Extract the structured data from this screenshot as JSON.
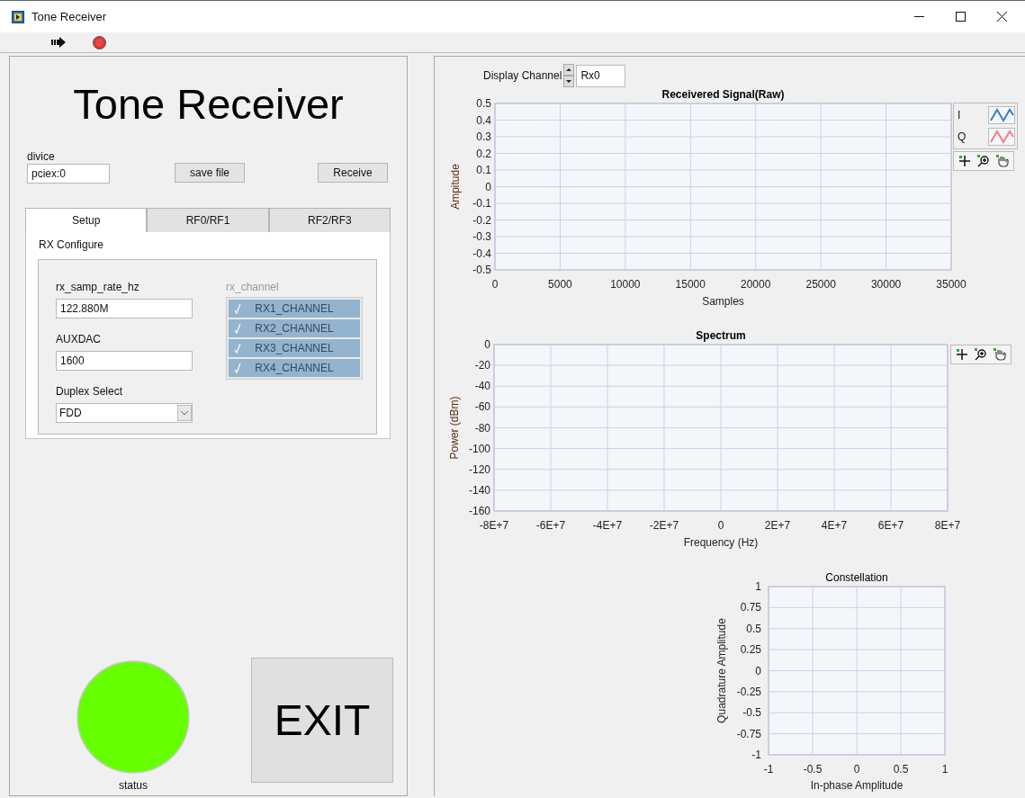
{
  "window": {
    "title": "Tone Receiver"
  },
  "heading": "Tone Receiver",
  "device": {
    "label": "divice",
    "value": "pciex:0"
  },
  "buttons": [
    "save file",
    "Receive"
  ],
  "tabs": [
    {
      "label": "Setup",
      "selected": true
    },
    {
      "label": "RF0/RF1",
      "selected": false
    },
    {
      "label": "RF2/RF3",
      "selected": false
    }
  ],
  "rx_configure": {
    "title": "RX Configure",
    "fields": [
      {
        "kind": "text",
        "label": "rx_samp_rate_hz",
        "value": "122.880M"
      },
      {
        "kind": "text",
        "label": "AUXDAC",
        "value": "1600"
      },
      {
        "kind": "dropdown",
        "label": "Duplex Select",
        "value": "FDD"
      }
    ],
    "rx_channel": {
      "label": "rx_channel",
      "disabled": true,
      "items": [
        {
          "label": "RX1_CHANNEL",
          "checked": true
        },
        {
          "label": "RX2_CHANNEL",
          "checked": true
        },
        {
          "label": "RX3_CHANNEL",
          "checked": true
        },
        {
          "label": "RX4_CHANNEL",
          "checked": true
        }
      ]
    }
  },
  "status": {
    "label": "status",
    "on": true
  },
  "exit_button": "EXIT",
  "display_channel": {
    "label": "Display Channel",
    "value": "Rx0"
  },
  "signal_graph": {
    "legend": [
      {
        "name": "I",
        "color": "#3a7fc1"
      },
      {
        "name": "Q",
        "color": "#f08080"
      }
    ],
    "chart_data": {
      "type": "line",
      "grid": true,
      "title": "Receivered Signal(Raw)",
      "xlabel": "Samples",
      "ylabel": "Ampitude",
      "xlim": [
        0,
        35000
      ],
      "ylim": [
        -0.5,
        0.5
      ],
      "xticks": [
        0,
        5000,
        10000,
        15000,
        20000,
        25000,
        30000,
        35000
      ],
      "yticks": [
        0.5,
        0.4,
        0.3,
        0.2,
        0.1,
        0,
        -0.1,
        -0.2,
        -0.3,
        -0.4,
        -0.5
      ]
    }
  },
  "spectrum_graph": {
    "chart_data": {
      "type": "line",
      "grid": true,
      "title": "Spectrum",
      "xlabel": "Frequency (Hz)",
      "ylabel": "Power (dBm)",
      "xlim": [
        -80000000,
        80000000
      ],
      "ylim": [
        -160,
        0
      ],
      "xticks": [
        {
          "value": -80000000,
          "label": "-8E+7"
        },
        {
          "value": -60000000,
          "label": "-6E+7"
        },
        {
          "value": -40000000,
          "label": "-4E+7"
        },
        {
          "value": -20000000,
          "label": "-2E+7"
        },
        {
          "value": 0,
          "label": "0"
        },
        {
          "value": 20000000,
          "label": "2E+7"
        },
        {
          "value": 40000000,
          "label": "4E+7"
        },
        {
          "value": 60000000,
          "label": "6E+7"
        },
        {
          "value": 80000000,
          "label": "8E+7"
        }
      ],
      "yticks": [
        0,
        -20,
        -40,
        -60,
        -80,
        -100,
        -120,
        -140,
        -160
      ]
    }
  },
  "constellation_graph": {
    "chart_data": {
      "type": "scatter",
      "grid": true,
      "title": "Constellation",
      "xlabel": "In-phase Amplitude",
      "ylabel": "Quadrature Amplitude",
      "xlim": [
        -1,
        1
      ],
      "ylim": [
        -1,
        1
      ],
      "xticks": [
        -1,
        -0.5,
        0,
        0.5,
        1
      ],
      "yticks": [
        1,
        0.75,
        0.5,
        0.25,
        0,
        -0.25,
        -0.5,
        -0.75,
        -1
      ]
    }
  }
}
